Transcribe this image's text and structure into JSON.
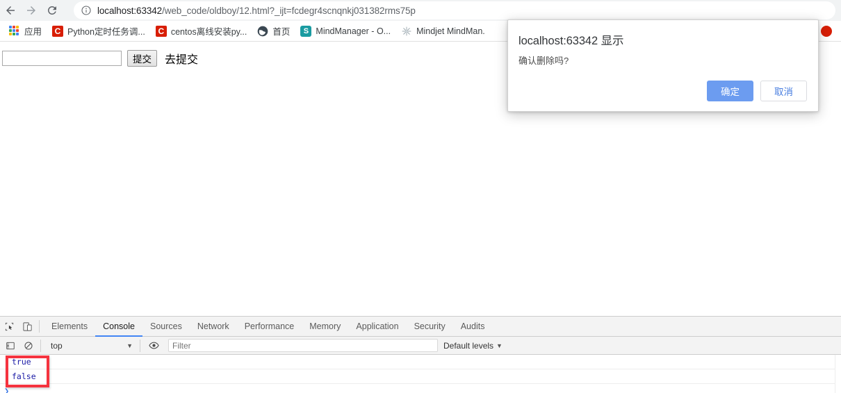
{
  "browser": {
    "nav": {
      "back_title": "Back",
      "forward_title": "Forward",
      "reload_title": "Reload this page"
    },
    "omnibox": {
      "info_icon": "info-circle-icon",
      "host": "localhost:63342",
      "path": "/web_code/oldboy/12.html?_ijt=fcdegr4scnqnkj031382rms75p"
    },
    "bookmarks": [
      {
        "label": "应用",
        "icon": "apps-grid-icon"
      },
      {
        "label": "Python定时任务调...",
        "icon": "csdn-icon",
        "icon_text": "C"
      },
      {
        "label": "centos离线安装py...",
        "icon": "csdn-icon",
        "icon_text": "C"
      },
      {
        "label": "首页",
        "icon": "globe-icon",
        "icon_text": "🌐"
      },
      {
        "label": "MindManager - O...",
        "icon": "mindmanager-icon",
        "icon_text": "S"
      },
      {
        "label": "Mindjet MindMan.",
        "icon": "starburst-icon"
      },
      {
        "label": "..",
        "icon": "overflow-icon"
      }
    ]
  },
  "page": {
    "input_value": "",
    "input_placeholder": "",
    "submit_label": "提交",
    "go_submit_label": "去提交"
  },
  "dialog": {
    "title": "localhost:63342 显示",
    "message": "确认删除吗?",
    "confirm_label": "确定",
    "cancel_label": "取消",
    "confirm_color": "#6c9cf0",
    "cancel_text_color": "#4a7fe0"
  },
  "devtools": {
    "tabs": [
      {
        "label": "Elements",
        "active": false
      },
      {
        "label": "Console",
        "active": true
      },
      {
        "label": "Sources",
        "active": false
      },
      {
        "label": "Network",
        "active": false
      },
      {
        "label": "Performance",
        "active": false
      },
      {
        "label": "Memory",
        "active": false
      },
      {
        "label": "Application",
        "active": false
      },
      {
        "label": "Security",
        "active": false
      },
      {
        "label": "Audits",
        "active": false
      }
    ],
    "console_bar": {
      "context": "top",
      "filter_value": "",
      "filter_placeholder": "Filter",
      "levels_label": "Default levels",
      "caret": "▼"
    },
    "console_output": [
      "true",
      "false"
    ],
    "prompt_symbol": "❯",
    "active_tab_underline_color": "#4285f4",
    "annotation_box_color": "#f5333f"
  }
}
